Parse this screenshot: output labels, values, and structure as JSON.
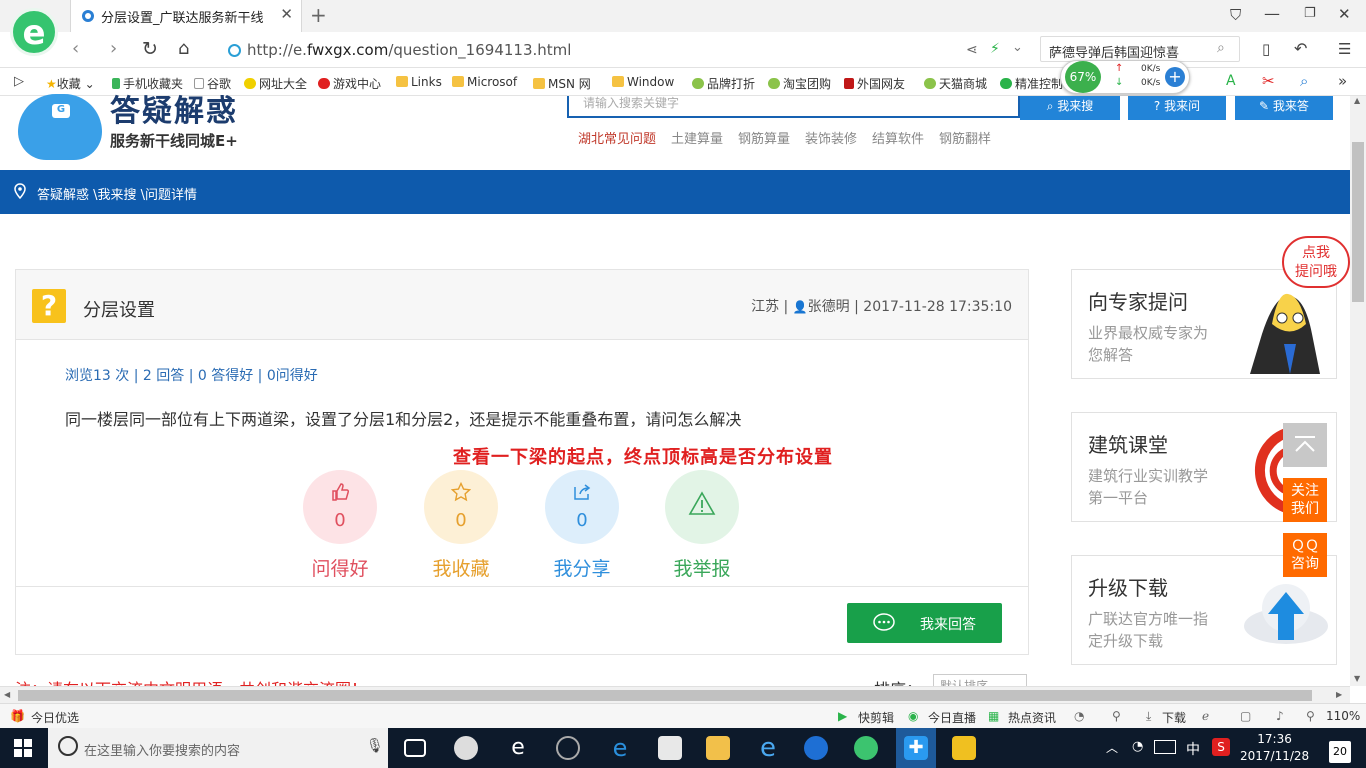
{
  "browser": {
    "tab_title": "分层设置_广联达服务新干线",
    "url_prefix": "http://e.",
    "url_domain": "fwxgx.com",
    "url_path": "/question_1694113.html",
    "search_box_text": "萨德导弹后韩国迎惊喜",
    "speed_percent": "67%",
    "upload_speed": "0K/s",
    "download_speed": "0K/s"
  },
  "favorites": [
    {
      "label": "收藏"
    },
    {
      "label": "手机收藏夹"
    },
    {
      "label": "谷歌"
    },
    {
      "label": "网址大全"
    },
    {
      "label": "游戏中心"
    },
    {
      "label": "Links"
    },
    {
      "label": "Microsof"
    },
    {
      "label": "MSN 网"
    },
    {
      "label": "Window"
    },
    {
      "label": "品牌打折"
    },
    {
      "label": "淘宝团购"
    },
    {
      "label": "外国网友"
    },
    {
      "label": "天猫商城"
    },
    {
      "label": "精准控制"
    }
  ],
  "header": {
    "brand_title": "答疑解惑",
    "brand_subtitle": "服务新干线同城E+",
    "search_placeholder": "请输入搜索关键字",
    "search_buttons": [
      "我来搜",
      "我来问",
      "我来答"
    ],
    "hot_links": [
      "湖北常见问题",
      "土建算量",
      "钢筋算量",
      "装饰装修",
      "结算软件",
      "钢筋翻样"
    ]
  },
  "breadcrumb": "答疑解惑 \\我来搜 \\问题详情",
  "question": {
    "title": "分层设置",
    "province": "江苏",
    "author": "张德明",
    "datetime": "2017-11-28 17:35:10",
    "stats": "浏览13 次 | 2 回答 | 0 答得好 | 0问得好",
    "body": "同一楼层同一部位有上下两道梁，设置了分层1和分层2，还是提示不能重叠布置，请问怎么解决",
    "annotation": "查看一下梁的起点，终点顶标高是否分布设置",
    "actions": [
      {
        "label": "问得好",
        "count": "0",
        "color": "#e0505f",
        "bg": "#fde3e6",
        "icon": "thumbs-up-icon"
      },
      {
        "label": "我收藏",
        "count": "0",
        "color": "#e6a02e",
        "bg": "#fdf0d6",
        "icon": "star-icon"
      },
      {
        "label": "我分享",
        "count": "0",
        "color": "#2f8fdc",
        "bg": "#ddeefb",
        "icon": "share-icon"
      },
      {
        "label": "我举报",
        "count": "",
        "color": "#3aa75a",
        "bg": "#e2f4e6",
        "icon": "warning-icon"
      }
    ],
    "reply_button": "我来回答"
  },
  "notice": "注：请在以下交流中文明用语，共创和谐交流圈！",
  "sort_label": "排序：",
  "sort_value": "默认排序",
  "sidebar": {
    "bubble": "点我\n提问哦",
    "cards": [
      {
        "title": "向专家提问",
        "desc": "业界最权威专家为您解答"
      },
      {
        "title": "建筑课堂",
        "desc": "建筑行业实训教学第一平台"
      },
      {
        "title": "升级下载",
        "desc": "广联达官方唯一指定升级下载"
      }
    ],
    "follow": "关注我们",
    "qq": "ＱＱ咨询"
  },
  "statusbar": {
    "left": "今日优选",
    "items": [
      "快剪辑",
      "今日直播",
      "热点资讯",
      "下载"
    ],
    "zoom": "110%"
  },
  "taskbar": {
    "search_placeholder": "在这里输入你要搜索的内容",
    "ime": "中",
    "time": "17:36",
    "date": "2017/11/28",
    "notifications": "20"
  },
  "colors": {
    "nav_blue": "#0e5aac",
    "reply_green": "#18a04a",
    "accent_red": "#e02020",
    "orange": "#ff6a00"
  }
}
